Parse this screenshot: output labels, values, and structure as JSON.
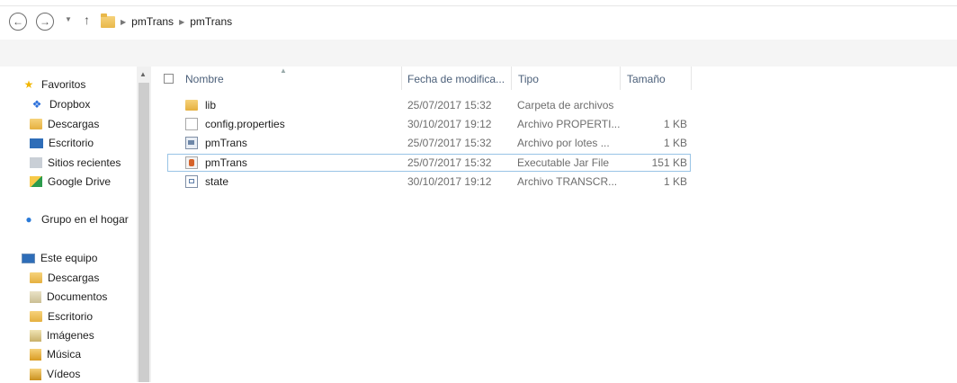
{
  "address_bar": {
    "back_glyph": "←",
    "forward_glyph": "→",
    "up_glyph": "↑",
    "breadcrumb": [
      "pmTrans",
      "pmTrans"
    ]
  },
  "nav": {
    "favorites": {
      "label": "Favoritos",
      "items": [
        {
          "label": "Dropbox",
          "icon": "dropbox-icon"
        },
        {
          "label": "Descargas",
          "icon": "downloads-folder-icon"
        },
        {
          "label": "Escritorio",
          "icon": "desktop-icon"
        },
        {
          "label": "Sitios recientes",
          "icon": "recent-places-icon"
        },
        {
          "label": "Google Drive",
          "icon": "google-drive-icon"
        }
      ]
    },
    "homegroup": {
      "label": "Grupo en el hogar"
    },
    "this_pc": {
      "label": "Este equipo",
      "items": [
        {
          "label": "Descargas",
          "icon": "downloads-folder-icon"
        },
        {
          "label": "Documentos",
          "icon": "documents-folder-icon"
        },
        {
          "label": "Escritorio",
          "icon": "desktop-icon"
        },
        {
          "label": "Imágenes",
          "icon": "pictures-folder-icon"
        },
        {
          "label": "Música",
          "icon": "music-folder-icon"
        },
        {
          "label": "Vídeos",
          "icon": "videos-folder-icon"
        }
      ]
    }
  },
  "columns": {
    "name": "Nombre",
    "date": "Fecha de modifica...",
    "type": "Tipo",
    "size": "Tamaño"
  },
  "files": [
    {
      "name": "lib",
      "date": "25/07/2017 15:32",
      "type": "Carpeta de archivos",
      "size": "",
      "icon": "folder-icon"
    },
    {
      "name": "config.properties",
      "date": "30/10/2017 19:12",
      "type": "Archivo PROPERTI...",
      "size": "1 KB",
      "icon": "file-icon"
    },
    {
      "name": "pmTrans",
      "date": "25/07/2017 15:32",
      "type": "Archivo por lotes ...",
      "size": "1 KB",
      "icon": "batch-file-icon"
    },
    {
      "name": "pmTrans",
      "date": "25/07/2017 15:32",
      "type": "Executable Jar File",
      "size": "151 KB",
      "icon": "jar-file-icon"
    },
    {
      "name": "state",
      "date": "30/10/2017 19:12",
      "type": "Archivo TRANSCR...",
      "size": "1 KB",
      "icon": "text-file-icon"
    }
  ],
  "selected_row_index": 3,
  "colors": {
    "header_text": "#4c607a",
    "selection_border": "#99c4e6",
    "meta_text": "#6d6d6d"
  }
}
